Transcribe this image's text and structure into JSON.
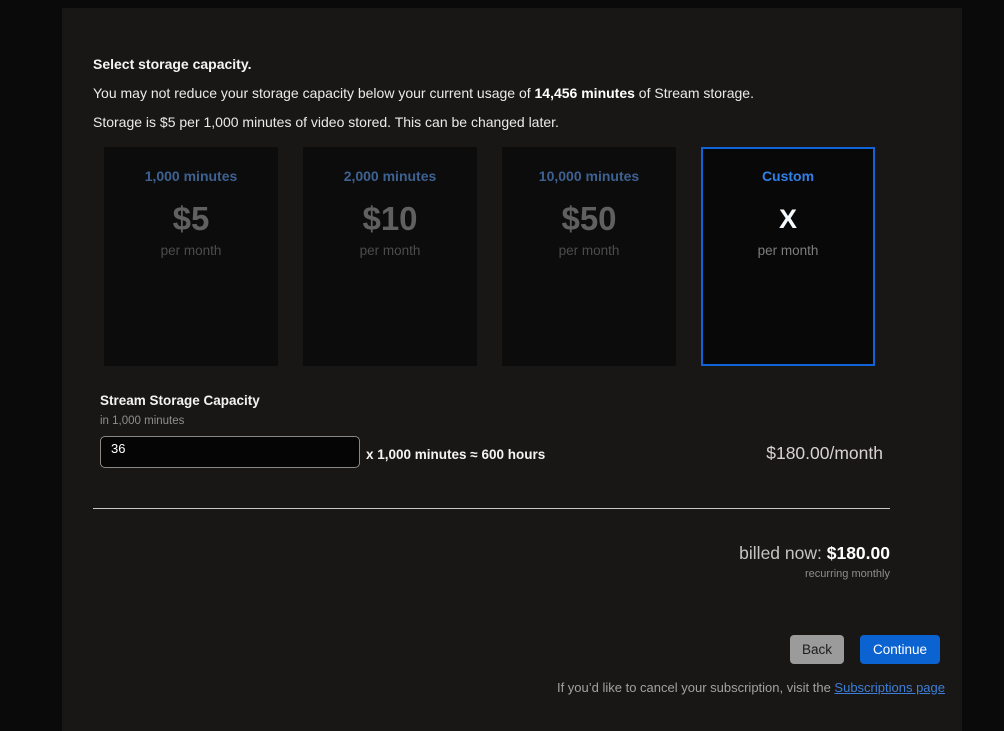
{
  "colors": {
    "accent_blue": "#1164d8",
    "selected_tile_border": "#1164d8",
    "tier_title_blue": "#3d6191",
    "selected_tier_title_blue": "#3180e8",
    "continue_button_bg": "#0b63d1",
    "back_button_bg": "#9b9b9b",
    "link_blue": "#3e7ed6",
    "panel_bg": "#181716",
    "page_bg": "#0a0a0a"
  },
  "intro": {
    "heading": "Select storage capacity.",
    "usage_prefix": "You may not reduce your storage capacity below your current usage of ",
    "usage_value": "14,456 minutes",
    "usage_suffix": " of Stream storage.",
    "pricing_note": "Storage is $5 per 1,000 minutes of video stored. This can be changed later."
  },
  "tiers": [
    {
      "title": "1,000 minutes",
      "price": "$5",
      "period": "per month",
      "selected": false
    },
    {
      "title": "2,000 minutes",
      "price": "$10",
      "period": "per month",
      "selected": false
    },
    {
      "title": "10,000 minutes",
      "price": "$50",
      "period": "per month",
      "selected": false
    },
    {
      "title": "Custom",
      "price": "X",
      "period": "per month",
      "selected": true
    }
  ],
  "capacity": {
    "label": "Stream Storage Capacity",
    "sublabel": "in 1,000 minutes",
    "input_value": "36",
    "conversion": "x 1,000 minutes ≈ 600 hours",
    "monthly_price": "$180.00/month"
  },
  "billing": {
    "billed_now_label": "billed now: ",
    "billed_now_amount": "$180.00",
    "recurrence": "recurring monthly"
  },
  "actions": {
    "back_label": "Back",
    "continue_label": "Continue"
  },
  "footer": {
    "cancel_text": "If you’d like to cancel your subscription, visit the ",
    "link_label": "Subscriptions page"
  }
}
